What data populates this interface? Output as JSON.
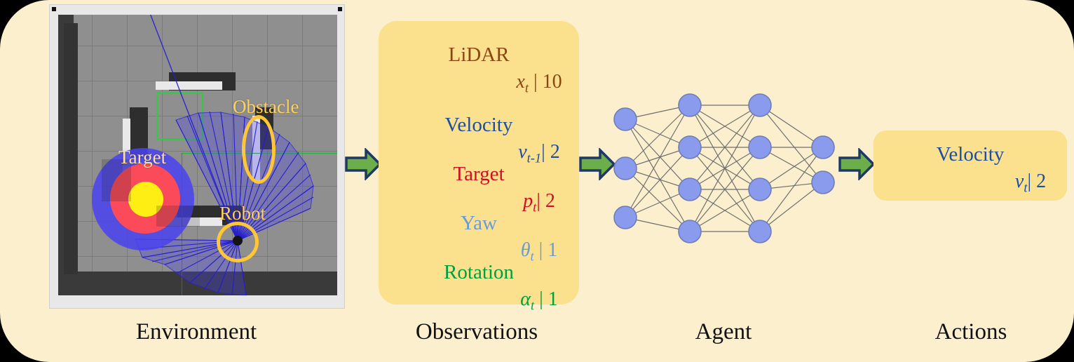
{
  "theme": {
    "page_background": "#000000",
    "panel_background": "#FBEFCE",
    "card_background": "#FBE08E",
    "arrow_fill": "#6CAE4A",
    "arrow_stroke": "#1F3864",
    "node_fill": "#8A9BEE",
    "node_stroke": "#6E7EB4",
    "edge_color": "#6F6F6F",
    "annotation_gold": "#FFC637",
    "lidar_blue": "#3a36e0"
  },
  "environment": {
    "caption": "Environment",
    "annotations": [
      {
        "name": "Obstacle",
        "label": "Obstacle"
      },
      {
        "name": "Target",
        "label": "Target"
      },
      {
        "name": "Robot",
        "label": "Robot"
      }
    ]
  },
  "observations": {
    "caption": "Observations",
    "items": [
      {
        "name": "LiDAR",
        "label": "LiDAR",
        "symbol": "x",
        "subscript": "t",
        "dimension": "10",
        "color": "#8B4513"
      },
      {
        "name": "Velocity",
        "label": "Velocity",
        "symbol": "v",
        "subscript": "t-1",
        "dimension": "2",
        "color": "#1F4E9C"
      },
      {
        "name": "Target",
        "label": "Target",
        "symbol": "p",
        "subscript": "t",
        "dimension": "2",
        "color": "#CC1122"
      },
      {
        "name": "Yaw",
        "label": "Yaw",
        "symbol": "θ",
        "subscript": "t",
        "dimension": "1",
        "color": "#6A9BD8"
      },
      {
        "name": "Rotation",
        "label": "Rotation",
        "symbol": "α",
        "subscript": "t",
        "dimension": "1",
        "color": "#00A03C"
      }
    ]
  },
  "agent": {
    "caption": "Agent",
    "network": {
      "layer_sizes": [
        3,
        4,
        4,
        2
      ]
    }
  },
  "actions": {
    "caption": "Actions",
    "items": [
      {
        "name": "Velocity",
        "label": "Velocity",
        "symbol": "v",
        "subscript": "t",
        "dimension": "2",
        "color": "#1F4E9C"
      }
    ]
  },
  "arrows": [
    {
      "name": "environment-to-observations"
    },
    {
      "name": "observations-to-agent"
    },
    {
      "name": "agent-to-actions"
    }
  ]
}
